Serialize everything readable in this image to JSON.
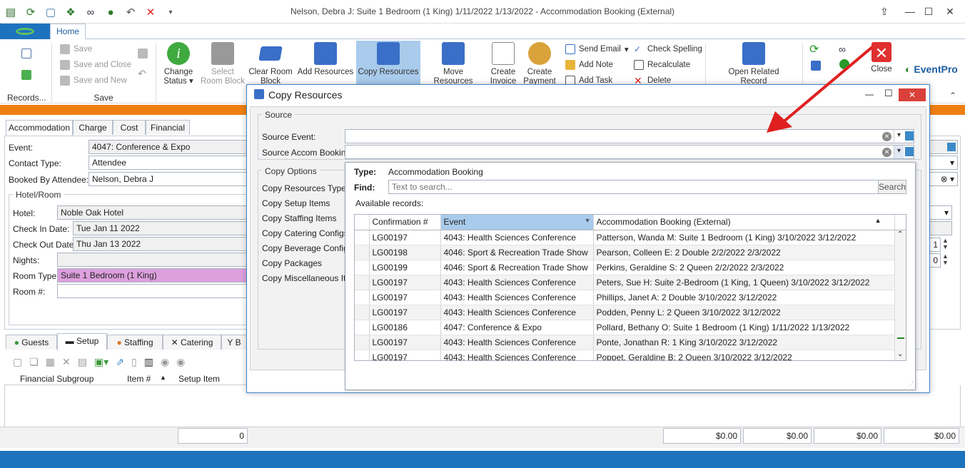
{
  "window": {
    "title": "Nelson, Debra J: Suite 1 Bedroom (1 King) 1/11/2022 1/13/2022  - Accommodation Booking (External)",
    "home_tab": "Home"
  },
  "ribbon": {
    "records_group": "Records...",
    "save_group": "Save",
    "save": "Save",
    "save_close": "Save and Close",
    "save_new": "Save and New",
    "change_status": [
      "Change",
      "Status"
    ],
    "select_room_block": [
      "Select",
      "Room Block"
    ],
    "clear_room_block": [
      "Clear Room",
      "Block"
    ],
    "add_resources": "Add Resources",
    "copy_resources": "Copy Resources",
    "move_resources": "Move Resources",
    "create_invoice": [
      "Create",
      "Invoice"
    ],
    "create_payment": [
      "Create",
      "Payment"
    ],
    "send_email": "Send Email",
    "add_note": "Add Note",
    "add_task": "Add Task",
    "check_spelling": "Check Spelling",
    "recalculate": "Recalculate",
    "delete": "Delete",
    "open_related": [
      "Open Related",
      "Record"
    ],
    "close": "Close",
    "brand": "EventPro"
  },
  "form": {
    "tabs": [
      "Accommodation",
      "Charge",
      "Cost",
      "Financial"
    ],
    "event_label": "Event:",
    "event_value": "4047: Conference & Expo",
    "contact_type_label": "Contact Type:",
    "contact_type_value": "Attendee",
    "booked_by_label": "Booked By Attendee:*",
    "booked_by_value": "Nelson, Debra J",
    "hotel_room_legend": "Hotel/Room",
    "hotel_label": "Hotel:",
    "hotel_value": "Noble Oak Hotel",
    "checkin_label": "Check In Date:",
    "checkin_value": "Tue Jan 11 2022",
    "checkout_label": "Check Out Date:",
    "checkout_value": "Thu Jan 13 2022",
    "nights_label": "Nights:",
    "room_type_label": "Room Type:",
    "room_type_value": "Suite 1 Bedroom (1 King)",
    "room_num_label": "Room #:",
    "spin1": "1",
    "spin2": "0"
  },
  "bottom": {
    "tabs": [
      "Guests",
      "Setup",
      "Staffing",
      "Catering",
      "B"
    ],
    "col_subgroup": "Financial Subgroup",
    "col_item": "Item #",
    "col_setup_item": "Setup Item",
    "count": "0",
    "totals": [
      "$0.00",
      "$0.00",
      "$0.00",
      "$0.00"
    ]
  },
  "dialog": {
    "title": "Copy Resources",
    "source_legend": "Source",
    "source_event_label": "Source Event:",
    "source_accom_label": "Source Accom Booking:",
    "copy_options_legend": "Copy Options",
    "options": [
      "Copy Resources Type:",
      "Copy Setup Items",
      "Copy Staffing Items",
      "Copy Catering Configs",
      "Copy Beverage Configs",
      "Copy Packages",
      "Copy Miscellaneous Item"
    ]
  },
  "popup": {
    "type_label": "Type:",
    "type_value": "Accommodation Booking",
    "find_label": "Find:",
    "find_placeholder": "Text to search...",
    "search_button": "Search",
    "available": "Available records:",
    "columns": [
      "Confirmation #",
      "Event",
      "Accommodation Booking (External)"
    ],
    "rows": [
      [
        "LG00197",
        "4043: Health Sciences Conference",
        "Patterson, Wanda M: Suite 1 Bedroom (1 King) 3/10/2022 3/12/2022"
      ],
      [
        "LG00198",
        "4046: Sport & Recreation Trade Show",
        "Pearson, Colleen E: 2 Double 2/2/2022 2/3/2022"
      ],
      [
        "LG00199",
        "4046: Sport & Recreation Trade Show",
        "Perkins, Geraldine S: 2 Queen 2/2/2022 2/3/2022"
      ],
      [
        "LG00197",
        "4043: Health Sciences Conference",
        "Peters, Sue H: Suite 2-Bedroom (1 King, 1 Queen) 3/10/2022 3/12/2022"
      ],
      [
        "LG00197",
        "4043: Health Sciences Conference",
        "Phillips, Janet A: 2 Double 3/10/2022 3/12/2022"
      ],
      [
        "LG00197",
        "4043: Health Sciences Conference",
        "Podden, Penny L: 2 Queen 3/10/2022 3/12/2022"
      ],
      [
        "LG00186",
        "4047: Conference & Expo",
        "Pollard, Bethany O: Suite 1 Bedroom (1 King) 1/11/2022 1/13/2022"
      ],
      [
        "LG00197",
        "4043: Health Sciences Conference",
        "Ponte, Jonathan R: 1 King 3/10/2022 3/12/2022"
      ],
      [
        "LG00197",
        "4043: Health Sciences Conference",
        "Poppet, Geraldine B: 2 Queen 3/10/2022 3/12/2022"
      ]
    ]
  },
  "colors": {
    "accent": "#1e73be",
    "orange": "#f07f12",
    "selected_header": "#a9cbec",
    "room_type_bg": "#dda0dd",
    "arrow": "#e02020"
  }
}
